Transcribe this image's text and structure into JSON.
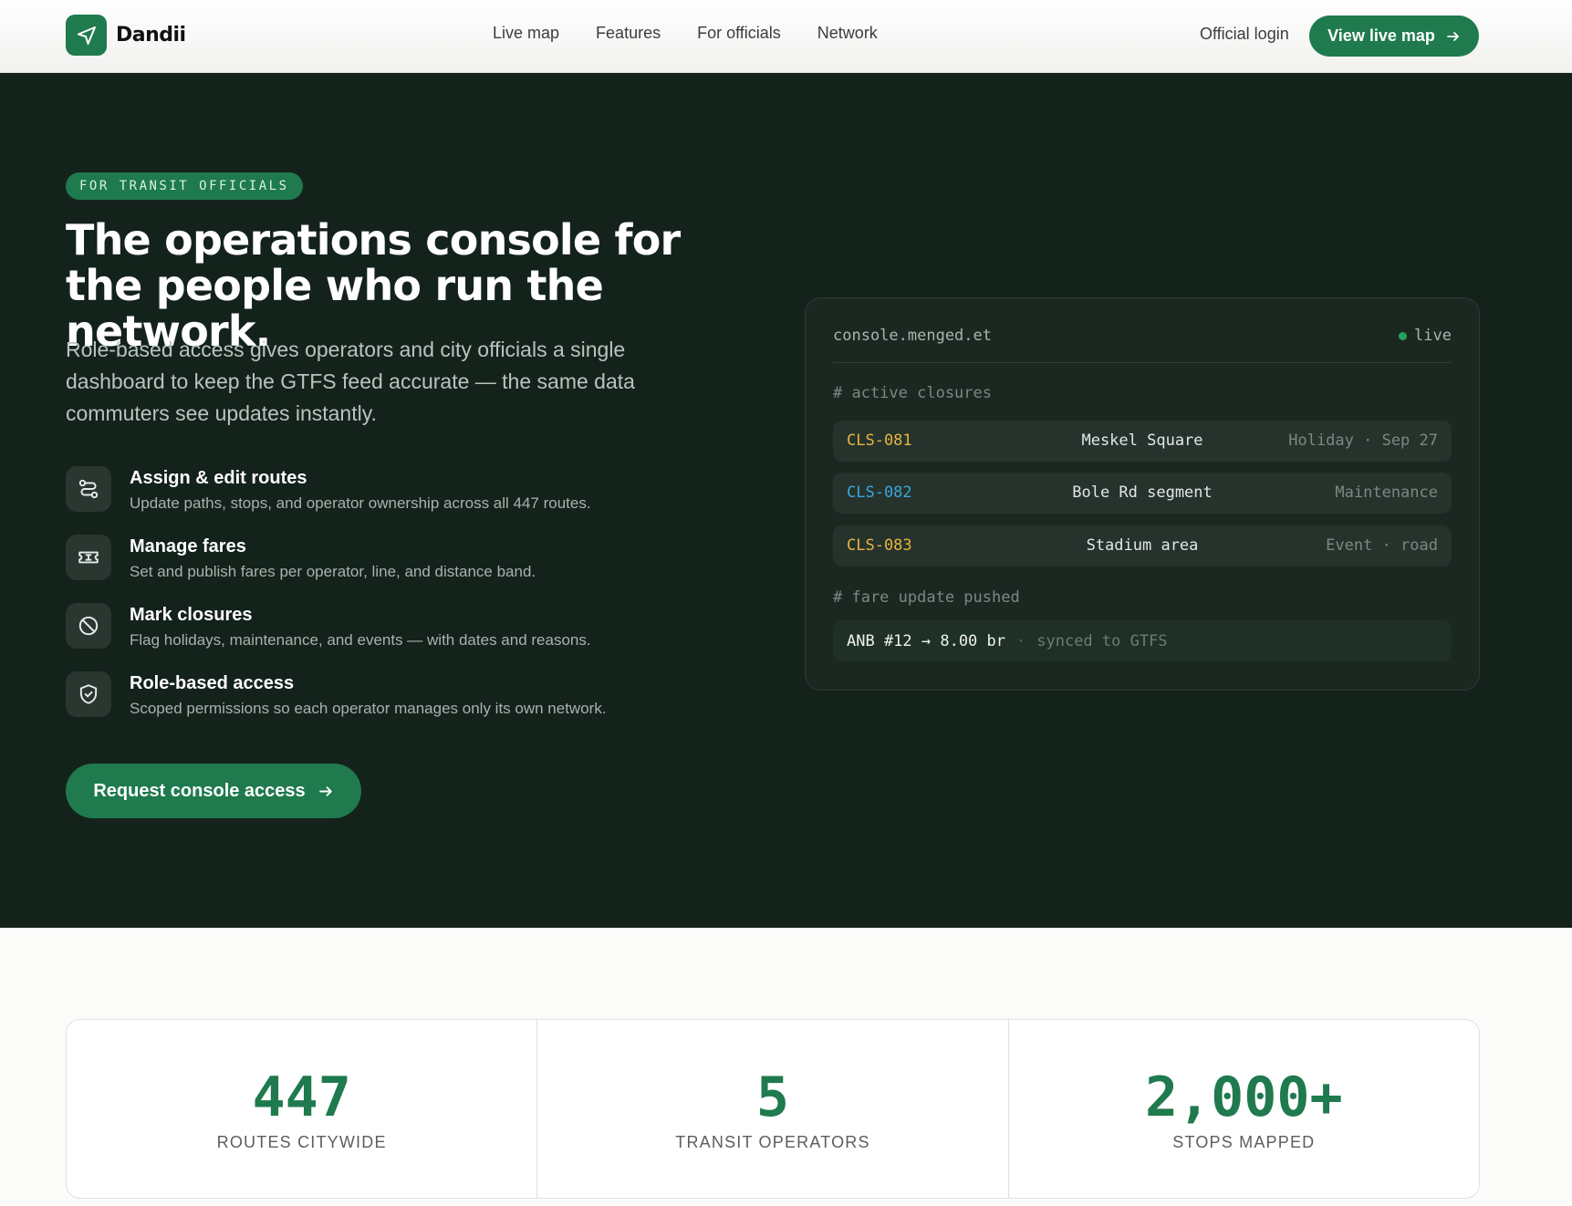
{
  "brand": {
    "name": "Dandii",
    "icon": "send-icon",
    "accent": "#1f7a4d"
  },
  "nav": {
    "links": [
      "Live map",
      "Features",
      "For officials",
      "Network"
    ],
    "login_label": "Official login",
    "cta_label": "View live map"
  },
  "hero": {
    "badge": "FOR TRANSIT OFFICIALS",
    "title": "The operations console for the people who run the network.",
    "subtitle": "Role-based access gives operators and city officials a single dashboard to keep the GTFS feed accurate — the same data commuters see updates instantly.",
    "features": [
      {
        "icon": "route-icon",
        "title": "Assign & edit routes",
        "desc": "Update paths, stops, and operator ownership across all 447 routes."
      },
      {
        "icon": "ticket-icon",
        "title": "Manage fares",
        "desc": "Set and publish fares per operator, line, and distance band."
      },
      {
        "icon": "ban-icon",
        "title": "Mark closures",
        "desc": "Flag holidays, maintenance, and events — with dates and reasons."
      },
      {
        "icon": "shield-check-icon",
        "title": "Role-based access",
        "desc": "Scoped permissions so each operator manages only its own network."
      }
    ],
    "cta_label": "Request console access"
  },
  "console": {
    "host": "console.menged.et",
    "status": "live",
    "closures_comment": "# active closures",
    "closures": [
      {
        "id": "CLS-081",
        "place": "Meskel Square",
        "tag": "Holiday · Sep 27",
        "color": "#e6b53e"
      },
      {
        "id": "CLS-082",
        "place": "Bole Rd segment",
        "tag": "Maintenance",
        "color": "#3aa7dc"
      },
      {
        "id": "CLS-083",
        "place": "Stadium area",
        "tag": "Event · road",
        "color": "#e6b53e"
      }
    ],
    "fare_comment": "# fare update pushed",
    "fare_update": "ANB #12 → 8.00 br",
    "fare_sep": "·",
    "fare_sync": "synced to GTFS"
  },
  "stats": [
    {
      "value": "447",
      "label": "ROUTES CITYWIDE"
    },
    {
      "value": "5",
      "label": "TRANSIT OPERATORS"
    },
    {
      "value": "2,000+",
      "label": "STOPS MAPPED"
    }
  ]
}
